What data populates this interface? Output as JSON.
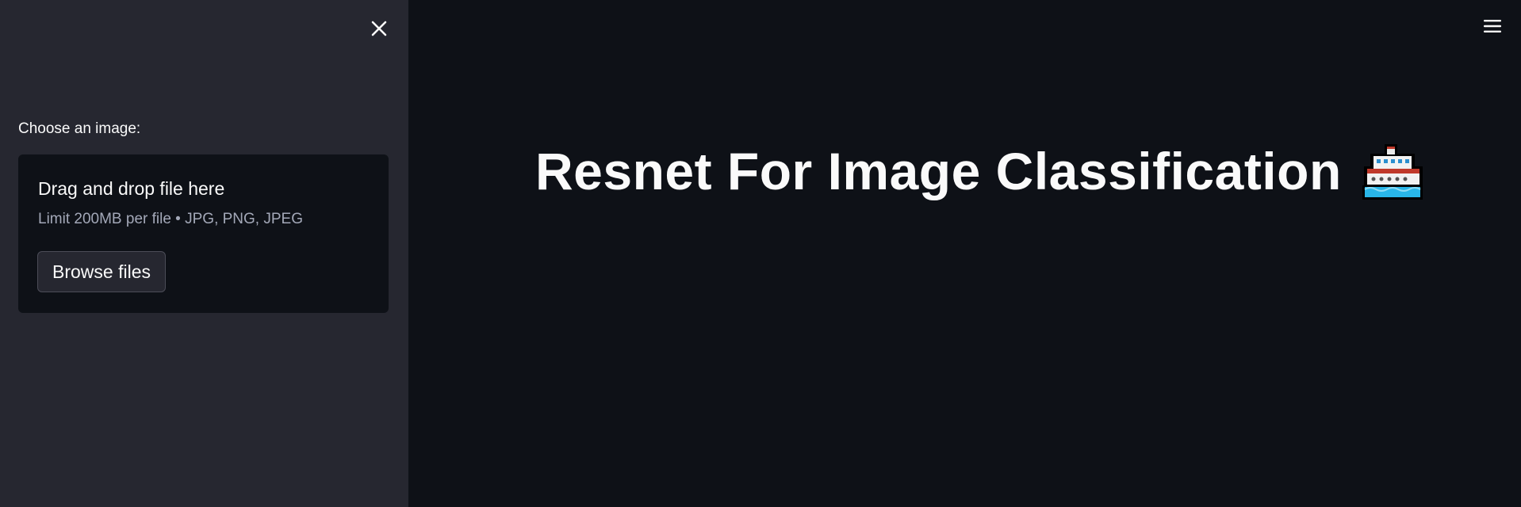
{
  "sidebar": {
    "uploader": {
      "label": "Choose an image:",
      "drop_title": "Drag and drop file here",
      "limit_text": "Limit 200MB per file • JPG, PNG, JPEG",
      "browse_label": "Browse files"
    },
    "close_icon": "close-icon"
  },
  "main": {
    "title": "Resnet For Image Classification",
    "title_emoji": "ship-icon",
    "menu_icon": "hamburger-menu-icon"
  },
  "colors": {
    "sidebar_bg": "#262730",
    "main_bg": "#0e1117",
    "text": "#fafafa",
    "muted_text": "#a3a8b8"
  }
}
